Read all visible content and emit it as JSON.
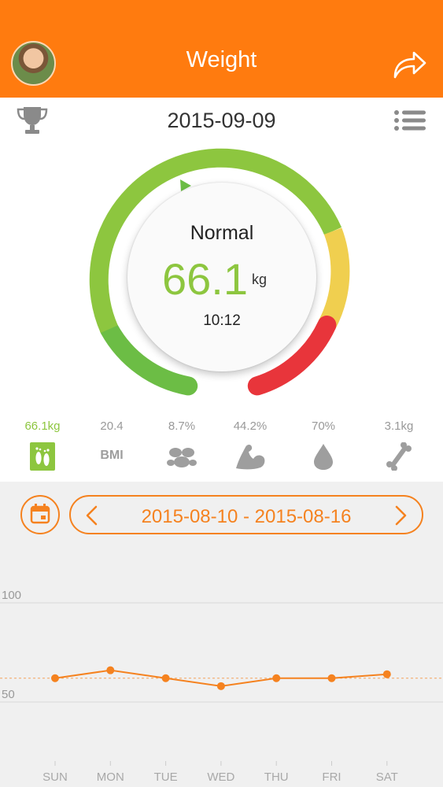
{
  "header": {
    "title": "Weight"
  },
  "date_bar": {
    "date": "2015-09-09"
  },
  "gauge": {
    "status": "Normal",
    "value": "66.1",
    "unit": "kg",
    "time": "10:12"
  },
  "metrics": [
    {
      "id": "weight",
      "value": "66.1kg",
      "icon": "footprints-icon"
    },
    {
      "id": "bmi",
      "value": "20.4",
      "label": "BMI"
    },
    {
      "id": "fat",
      "value": "8.7%",
      "icon": "fat-icon"
    },
    {
      "id": "muscle",
      "value": "44.2%",
      "icon": "muscle-icon"
    },
    {
      "id": "water",
      "value": "70%",
      "icon": "water-drop-icon"
    },
    {
      "id": "bone",
      "value": "3.1kg",
      "icon": "bone-icon"
    }
  ],
  "colors": {
    "orange": "#ff7b0f",
    "accent": "#f5821f",
    "green": "#8dc63f",
    "dark_green": "#6cbd45",
    "yellow": "#f0cf4f",
    "red": "#e8353b"
  },
  "range": {
    "label": "2015-08-10 - 2015-08-16"
  },
  "chart_data": {
    "type": "line",
    "categories": [
      "SUN",
      "MON",
      "TUE",
      "WED",
      "THU",
      "FRI",
      "SAT"
    ],
    "series": [
      {
        "values": [
          62,
          66,
          62,
          58,
          62,
          62,
          64
        ]
      }
    ],
    "y_ticks": [
      100,
      50
    ],
    "ylim": [
      50,
      100
    ],
    "reference_line": 62,
    "grid": true
  }
}
